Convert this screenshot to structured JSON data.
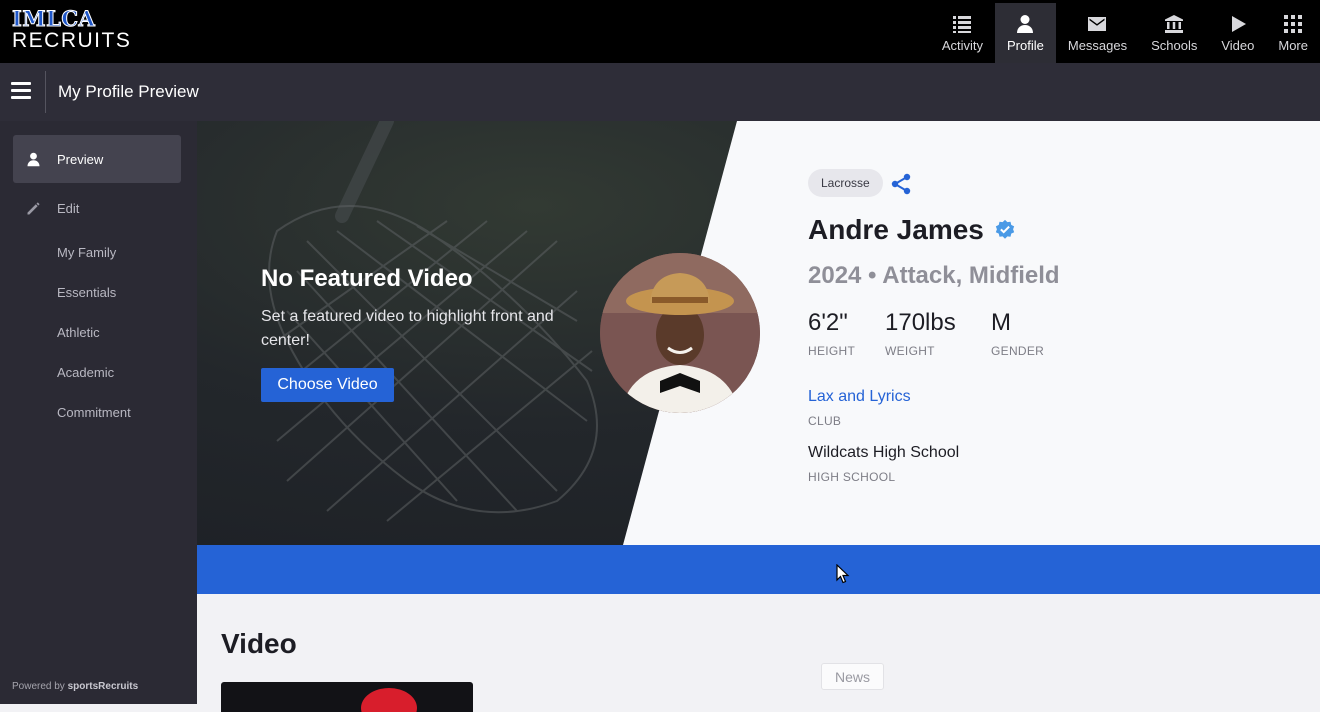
{
  "brand": {
    "line1": "IMLCA",
    "line2": "RECRUITS"
  },
  "nav": [
    {
      "label": "Activity",
      "icon": "list-icon",
      "active": false
    },
    {
      "label": "Profile",
      "icon": "person-icon",
      "active": true
    },
    {
      "label": "Messages",
      "icon": "envelope-icon",
      "active": false
    },
    {
      "label": "Schools",
      "icon": "bank-icon",
      "active": false
    },
    {
      "label": "Video",
      "icon": "play-icon",
      "active": false
    },
    {
      "label": "More",
      "icon": "grid-icon",
      "active": false
    }
  ],
  "header": {
    "title": "My Profile Preview"
  },
  "sidebar": {
    "items": [
      {
        "label": "Preview",
        "icon": "person-icon",
        "active": true
      },
      {
        "label": "Edit",
        "icon": "pencil-icon",
        "active": false
      },
      {
        "label": "My Family"
      },
      {
        "label": "Essentials"
      },
      {
        "label": "Athletic"
      },
      {
        "label": "Academic"
      },
      {
        "label": "Commitment"
      }
    ],
    "powered_prefix": "Powered by",
    "powered_brand": "sportsRecruits"
  },
  "featured": {
    "title": "No Featured Video",
    "text": "Set a featured video to highlight front and center!",
    "button": "Choose Video"
  },
  "profile": {
    "sport": "Lacrosse",
    "name": "Andre James",
    "subline": "2024 • Attack, Midfield",
    "stats": [
      {
        "value": "6'2\"",
        "label": "HEIGHT"
      },
      {
        "value": "170lbs",
        "label": "WEIGHT"
      },
      {
        "value": "M",
        "label": "GENDER"
      }
    ],
    "club": "Lax and Lyrics",
    "club_label": "CLUB",
    "high_school": "Wildcats High School",
    "high_school_label": "HIGH SCHOOL"
  },
  "sections": {
    "video_heading": "Video"
  },
  "tooltip": {
    "news": "News"
  },
  "colors": {
    "accent": "#2563d6",
    "topbar": "#000000",
    "sidebar": "#2b2a34",
    "subheader": "#2e2d38",
    "verified": "#4a9ae6"
  }
}
